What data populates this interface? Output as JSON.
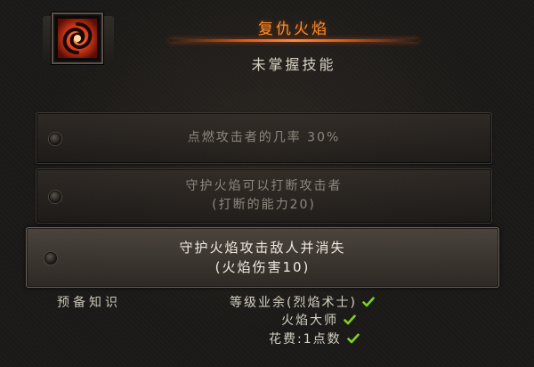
{
  "skill": {
    "name": "复仇火焰",
    "status": "未掌握技能",
    "icon": "flame-swirl-icon"
  },
  "runes": [
    {
      "lines": [
        "点燃攻击者的几率 30%"
      ],
      "selected": false
    },
    {
      "lines": [
        "守护火焰可以打断攻击者",
        "(打断的能力20)"
      ],
      "selected": false
    },
    {
      "lines": [
        "守护火焰攻击敌人并消失",
        "(火焰伤害10)"
      ],
      "selected": true
    }
  ],
  "prerequisites": {
    "label": "预备知识",
    "items": [
      {
        "text": "等级业余(烈焰术士)",
        "met": true
      },
      {
        "text": "火焰大师",
        "met": true
      },
      {
        "text": "花费:1点数",
        "met": true
      }
    ]
  },
  "colors": {
    "title": "#ff8a2a",
    "check": "#7ed321",
    "selected_text": "#efeae0",
    "muted_text": "#8e877e"
  }
}
